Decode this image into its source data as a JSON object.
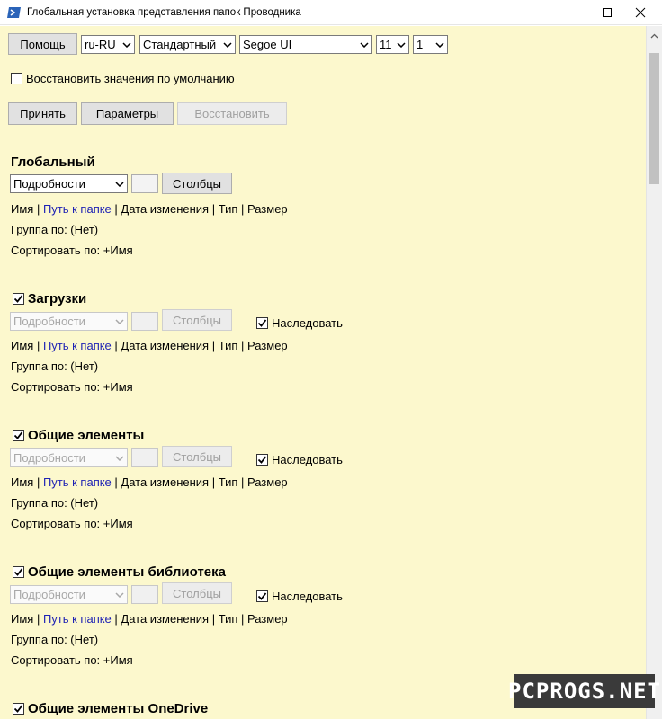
{
  "window": {
    "title": "Глобальная установка представления папок Проводника"
  },
  "toolbar": {
    "help_label": "Помощь",
    "language": "ru-RU",
    "style": "Стандартный",
    "font": "Segoe UI",
    "font_size": "11",
    "scale": "1",
    "restore_defaults_label": "Восстановить значения по умолчанию",
    "apply_label": "Принять",
    "params_label": "Параметры",
    "restore_label": "Восстановить"
  },
  "sections": [
    {
      "title": "Глобальный",
      "checkbox": false,
      "view": "Подробности",
      "columns_label": "Столбцы",
      "inherit_label": "",
      "cols": [
        "Имя",
        "Путь к папке",
        "Дата изменения",
        "Тип",
        "Размер"
      ],
      "group": "Группа по: (Нет)",
      "sort": "Сортировать по: +Имя"
    },
    {
      "title": "Загрузки",
      "checkbox": true,
      "view": "Подробности",
      "columns_label": "Столбцы",
      "inherit_label": "Наследовать",
      "cols": [
        "Имя",
        "Путь к папке",
        "Дата изменения",
        "Тип",
        "Размер"
      ],
      "group": "Группа по: (Нет)",
      "sort": "Сортировать по: +Имя"
    },
    {
      "title": "Общие элементы",
      "checkbox": true,
      "view": "Подробности",
      "columns_label": "Столбцы",
      "inherit_label": "Наследовать",
      "cols": [
        "Имя",
        "Путь к папке",
        "Дата изменения",
        "Тип",
        "Размер"
      ],
      "group": "Группа по: (Нет)",
      "sort": "Сортировать по: +Имя"
    },
    {
      "title": "Общие элементы библиотека",
      "checkbox": true,
      "view": "Подробности",
      "columns_label": "Столбцы",
      "inherit_label": "Наследовать",
      "cols": [
        "Имя",
        "Путь к папке",
        "Дата изменения",
        "Тип",
        "Размер"
      ],
      "group": "Группа по: (Нет)",
      "sort": "Сортировать по: +Имя"
    },
    {
      "title": "Общие элементы OneDrive",
      "checkbox": true
    }
  ],
  "watermark": "PCPROGS.NET",
  "colors": {
    "background": "#fcf8cd",
    "link": "#1e22b4"
  }
}
